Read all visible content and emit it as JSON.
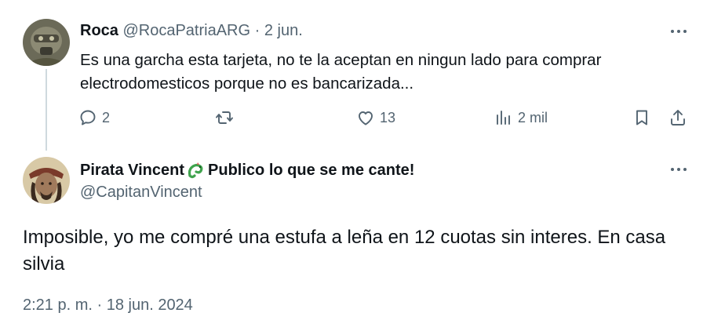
{
  "reply": {
    "name": "Roca",
    "handle": "@RocaPatriaARG",
    "separator": "·",
    "date": "2 jun.",
    "text": "Es una garcha esta tarjeta, no te la aceptan en ningun lado para comprar electrodomesticos porque no es bancarizada...",
    "actions": {
      "replies": "2",
      "retweets": "",
      "likes": "13",
      "views": "2 mil"
    }
  },
  "main": {
    "name": "Pirata Vincent",
    "name_suffix": "Publico lo que se me cante!",
    "handle": "@CapitanVincent",
    "text": "Imposible, yo me compré una estufa a leña en 12 cuotas sin interes. En casa silvia",
    "timestamp": "2:21 p. m. · 18 jun. 2024"
  },
  "icons": [
    "more-icon",
    "reply-icon",
    "retweet-icon",
    "like-icon",
    "views-icon",
    "bookmark-icon",
    "share-icon",
    "dragon-emoji-icon"
  ],
  "colors": {
    "text": "#0f1419",
    "secondary": "#536471",
    "thread_line": "#cfd9de",
    "background": "#ffffff"
  }
}
